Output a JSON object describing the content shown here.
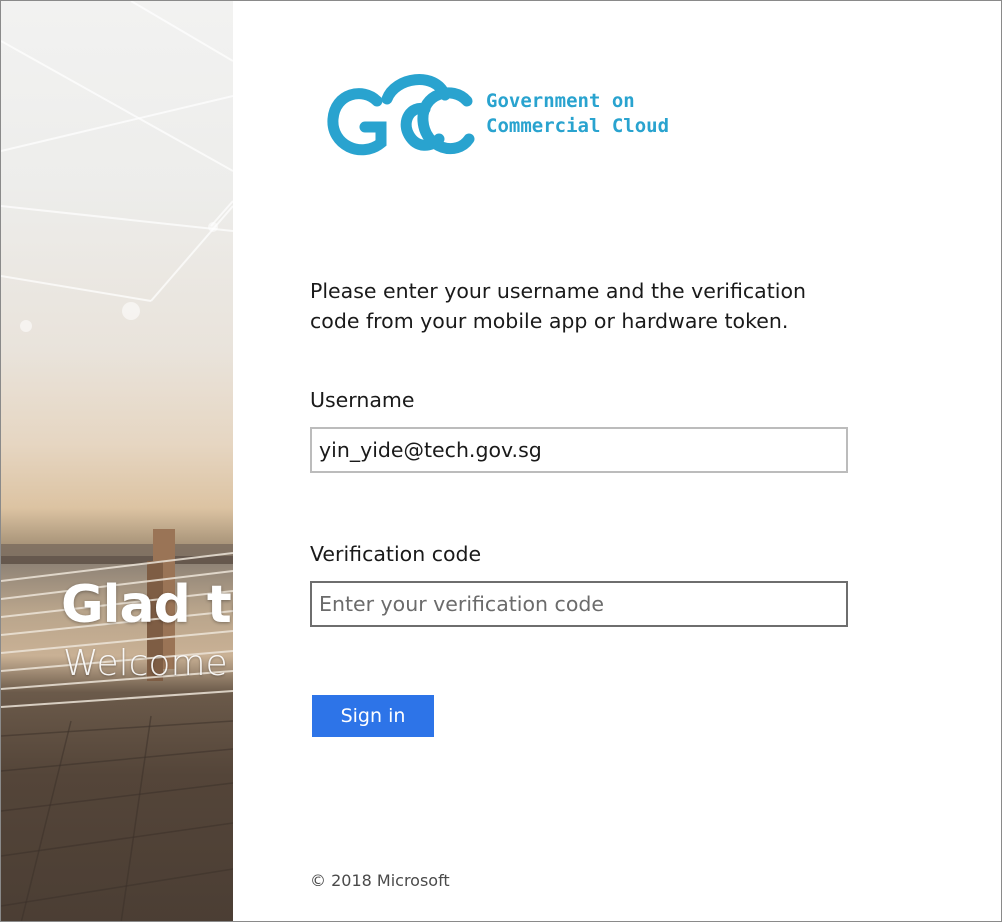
{
  "hero": {
    "headline": "Glad to",
    "subheadline": "Welcome"
  },
  "logo": {
    "line1": "Government on",
    "line2": "Commercial Cloud",
    "color": "#29a3cf"
  },
  "form": {
    "instructions": "Please enter your username and the verification code from your mobile app or hardware token.",
    "username_label": "Username",
    "username_value": "yin_yide@tech.gov.sg",
    "code_label": "Verification code",
    "code_placeholder": "Enter your verification code",
    "code_value": "",
    "signin_label": "Sign in",
    "accent_color": "#2d74e8"
  },
  "footer": {
    "copyright": "© 2018 Microsoft"
  }
}
